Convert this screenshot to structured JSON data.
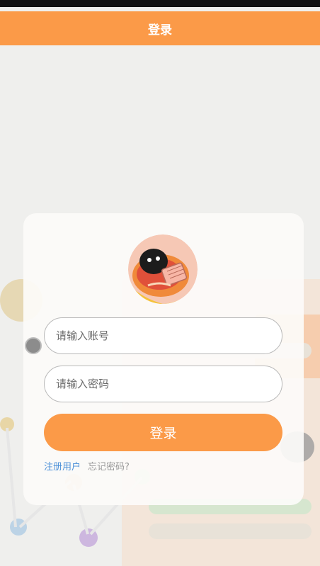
{
  "header": {
    "title": "登录"
  },
  "login": {
    "account_placeholder": "请输入账号",
    "password_placeholder": "请输入密码",
    "submit_label": "登录",
    "register_link": "注册用户",
    "forgot_link": "忘记密码?"
  },
  "colors": {
    "accent": "#fb9a48",
    "link": "#4a8fd8",
    "muted": "#999999"
  },
  "icons": {
    "avatar": "cartoon-avatar-icon",
    "floating": "floating-dot-icon"
  }
}
